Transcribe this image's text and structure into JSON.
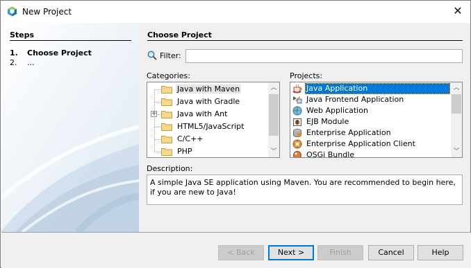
{
  "window": {
    "title": "New Project",
    "close_glyph": "✕"
  },
  "steps": {
    "heading": "Steps",
    "items": [
      {
        "number": "1.",
        "label": "Choose Project"
      },
      {
        "number": "2.",
        "label": "..."
      }
    ]
  },
  "main": {
    "heading": "Choose Project",
    "filter": {
      "label": "Filter:",
      "value": "",
      "placeholder": ""
    },
    "categories": {
      "label": "Categories:",
      "items": [
        {
          "label": "Java with Maven",
          "selected": true,
          "expandable": false
        },
        {
          "label": "Java with Gradle",
          "selected": false,
          "expandable": false
        },
        {
          "label": "Java with Ant",
          "selected": false,
          "expandable": true,
          "expander_glyph": "+"
        },
        {
          "label": "HTML5/JavaScript",
          "selected": false,
          "expandable": false
        },
        {
          "label": "C/C++",
          "selected": false,
          "expandable": false
        },
        {
          "label": "PHP",
          "selected": false,
          "expandable": false
        }
      ]
    },
    "projects": {
      "label": "Projects:",
      "items": [
        {
          "label": "Java Application",
          "icon": "coffee-cup-icon",
          "selected": true
        },
        {
          "label": "Java Frontend Application",
          "icon": "frontend-app-icon",
          "selected": false
        },
        {
          "label": "Web Application",
          "icon": "globe-icon",
          "selected": false
        },
        {
          "label": "EJB Module",
          "icon": "bean-module-icon",
          "selected": false
        },
        {
          "label": "Enterprise Application",
          "icon": "enterprise-app-icon",
          "selected": false
        },
        {
          "label": "Enterprise Application Client",
          "icon": "enterprise-client-icon",
          "selected": false
        },
        {
          "label": "OSGi Bundle",
          "icon": "bundle-icon",
          "selected": false
        }
      ]
    },
    "description": {
      "label": "Description:",
      "text": "A simple Java SE application using Maven. You are recommended to begin here, if you are new to Java!"
    }
  },
  "buttons": {
    "back": "< Back",
    "next": "Next >",
    "finish": "Finish",
    "cancel": "Cancel",
    "help": "Help"
  },
  "colors": {
    "selection": "#0078d7",
    "panel_background": "#f0f0f0",
    "folder": "#f5d78e"
  }
}
